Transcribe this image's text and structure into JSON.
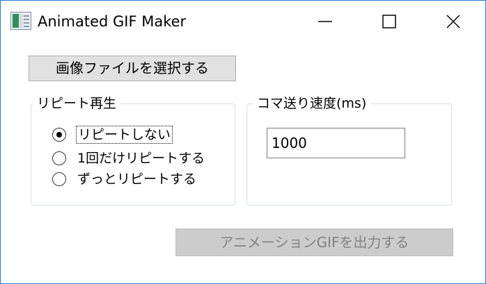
{
  "window": {
    "title": "Animated GIF Maker",
    "accent_border": "#1c7bd4"
  },
  "controls": {
    "select_file_label": "画像ファイルを選択する",
    "repeat_group_label": "リピート再生",
    "repeat_options": [
      {
        "label": "リピートしない",
        "selected": true
      },
      {
        "label": "1回だけリピートする",
        "selected": false
      },
      {
        "label": "ずっとリピートする",
        "selected": false
      }
    ],
    "speed_group_label": "コマ送り速度(ms)",
    "speed_value": "1000",
    "output_label": "アニメーションGIFを出力する",
    "output_enabled": false
  }
}
